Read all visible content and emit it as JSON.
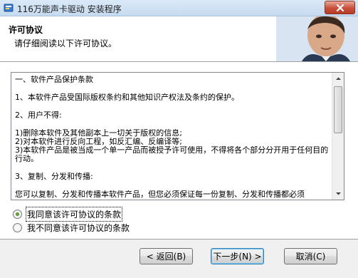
{
  "window": {
    "title": "116万能声卡驱动 安装程序",
    "close_label": "close"
  },
  "header": {
    "title": "许可协议",
    "subtitle": "请仔细阅读以下许可协议。"
  },
  "license": {
    "lines": [
      "一、软件产品保护条款",
      "1、本软件产品受国际版权条约和其他知识产权法及条约的保护。",
      "2、用户不得:",
      "1)删除本软件及其他副本上一切关于版权的信息;",
      "2)对本软件进行反向工程，如反汇编、反编译等;",
      "3)本软件产品是被当成一个单一产品而被授予许可使用，不得将各个部分分开用于任何目的行动。",
      "3、复制、分发和传播:",
      "您可以复制、分发和传播本软件产品，但您必须保证每一份复制、分发和传播都必须"
    ]
  },
  "options": {
    "accept": "我同意该许可协议的条款",
    "decline": "我不同意该许可协议的条款",
    "selected": "accept"
  },
  "buttons": {
    "back": "< 返回(B)",
    "next": "下一步(N) >",
    "cancel": "取消(C)"
  },
  "colors": {
    "titlebar": "#c6dbf0",
    "close": "#c7503b",
    "default_button_border": "#3c7fb1"
  }
}
